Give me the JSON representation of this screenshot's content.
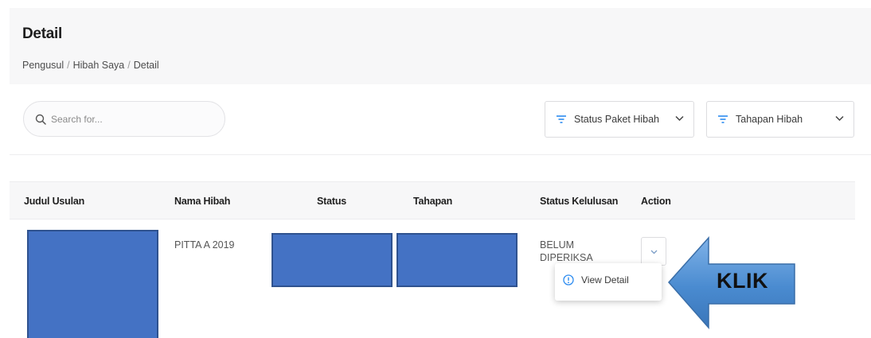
{
  "header": {
    "title": "Detail",
    "breadcrumb": [
      "Pengusul",
      "Hibah Saya",
      "Detail"
    ],
    "breadcrumb_sep": "/"
  },
  "search": {
    "placeholder": "Search for..."
  },
  "filters": {
    "status": "Status Paket Hibah",
    "tahapan": "Tahapan Hibah"
  },
  "table": {
    "columns": [
      "Judul Usulan",
      "Nama Hibah",
      "Status",
      "Tahapan",
      "Status Kelulusan",
      "Action"
    ],
    "rows": [
      {
        "nama_hibah": "PITTA A 2019",
        "status_kelulusan": "BELUM DIPERIKSA"
      }
    ]
  },
  "dropdown": {
    "view_detail": "View Detail"
  },
  "callout": {
    "label": "KLIK"
  },
  "colors": {
    "redaction": "#4472c4",
    "arrow": "#4a8bd0",
    "accent": "#2d8cf0"
  }
}
